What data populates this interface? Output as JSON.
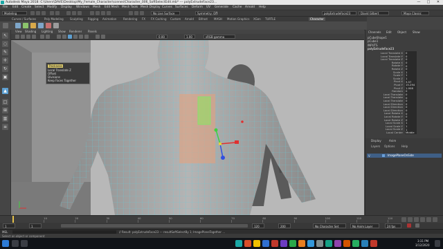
{
  "window": {
    "title": "Autodesk Maya 2018: C:\\Users\\DAVE\\Desktop\\My_Female_Character\\scenes\\Character_006_SoftSelectEdit.mb* --- polyExtrudeFace23...",
    "controls": [
      "—",
      "□",
      "✕"
    ]
  },
  "menubar": {
    "items": [
      "File",
      "Edit",
      "Create",
      "Select",
      "Modify",
      "Display",
      "Windows",
      "Mesh",
      "Edit Mesh",
      "Mesh Tools",
      "Mesh Display",
      "Curves",
      "Surfaces",
      "Deform",
      "UV",
      "Generate",
      "Cache",
      "Arnold",
      "Help"
    ]
  },
  "statusline": {
    "menuset": "Modeling",
    "no_live_surface": "No Live Surface",
    "symmetry": "Symmetry: Off",
    "object_field": "polyExtrudeFace23",
    "user": "David Gilbert",
    "workspace": "Maya Classic"
  },
  "shelf": {
    "tabs": [
      "Curves / Surfaces",
      "Poly Modeling",
      "Sculpting",
      "Rigging",
      "Animation",
      "Rendering",
      "FX",
      "FX Caching",
      "Custom",
      "Arnold",
      "Bifrost",
      "MASH",
      "Motion Graphics",
      "XGen",
      "TURTLE",
      "Character"
    ],
    "active_tab": "Character"
  },
  "viewport": {
    "menus": [
      "View",
      "Shading",
      "Lighting",
      "Show",
      "Renderer",
      "Panels"
    ],
    "exposure": "0.00",
    "gamma": "1.00",
    "colorspace": "sRGB gamma"
  },
  "popup": {
    "items": [
      "Thickness",
      "Local Translate Z",
      "Offset",
      "Divisions",
      "Keep Faces Together"
    ],
    "selected": "Thickness"
  },
  "channelbox": {
    "tabs": [
      "Channels",
      "Edit",
      "Object",
      "Show"
    ],
    "shape_name": "pCubeShape1",
    "instance": "pCube1",
    "inputs_label": "INPUTS",
    "node": "polyExtrudeFace23",
    "attrs": [
      {
        "name": "Local Translate X",
        "value": "0"
      },
      {
        "name": "Local Translate Y",
        "value": "0"
      },
      {
        "name": "Local Translate Z",
        "value": "0"
      },
      {
        "name": "Rotate X",
        "value": "0"
      },
      {
        "name": "Rotate Y",
        "value": "0"
      },
      {
        "name": "Rotate Z",
        "value": "0"
      },
      {
        "name": "Scale X",
        "value": "1"
      },
      {
        "name": "Scale Y",
        "value": "1"
      },
      {
        "name": "Scale Z",
        "value": "1"
      },
      {
        "name": "Pivot X",
        "value": "3.57"
      },
      {
        "name": "Pivot Y",
        "value": "15.294"
      },
      {
        "name": "Pivot Z",
        "value": "1.008"
      },
      {
        "name": "Random",
        "value": "0"
      },
      {
        "name": "Local Translate",
        "value": "0"
      },
      {
        "name": "Local Translate",
        "value": "0"
      },
      {
        "name": "Local Translate",
        "value": "0"
      },
      {
        "name": "Local Direction",
        "value": "0"
      },
      {
        "name": "Local Direction",
        "value": "0"
      },
      {
        "name": "Local Direction",
        "value": "0"
      },
      {
        "name": "Local Rotate X",
        "value": "0"
      },
      {
        "name": "Local Rotate Y",
        "value": "0"
      },
      {
        "name": "Local Rotate Z",
        "value": "0"
      },
      {
        "name": "Local Scale X",
        "value": "1"
      },
      {
        "name": "Local Scale Y",
        "value": "1"
      },
      {
        "name": "Local Scale Z",
        "value": "1"
      },
      {
        "name": "Local Center",
        "value": "Middle"
      }
    ]
  },
  "layers": {
    "tabs": [
      "Display",
      "Anim"
    ],
    "menus": [
      "Layers",
      "Options",
      "Help"
    ],
    "row": "ImagePlaneOnSide"
  },
  "timeslider": {
    "ticks": [
      "1",
      "10",
      "20",
      "30",
      "40",
      "50",
      "60",
      "70",
      "80",
      "90",
      "100",
      "110",
      "120"
    ],
    "current_frame": "1"
  },
  "rangeslider": {
    "start": "1",
    "start_inner": "1",
    "end_inner": "120",
    "end": "200",
    "fps": "24 fps",
    "character_set": "No Character Set",
    "anim_layer": "No Anim Layer"
  },
  "cmdline": {
    "language": "MEL",
    "result": "// Result: polyExtrudeFace23 --- resultSoftSelectBy 1; ImagePlaneTogether ..."
  },
  "helpline": {
    "text": "Select an object or component"
  },
  "taskbar": {
    "time": "3:31 PM",
    "date": "3/12/2020"
  },
  "colors": {
    "accent": "#5d9fd1",
    "popup_highlight": "#d6c56a",
    "wire_cyan": "#5fd0e0",
    "soft_select": "#e8a07a"
  }
}
